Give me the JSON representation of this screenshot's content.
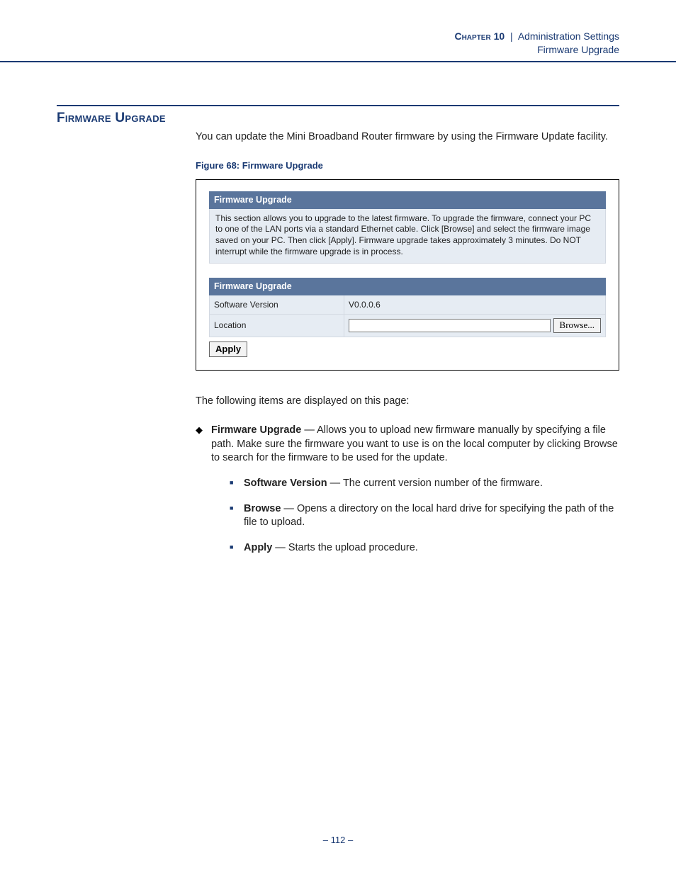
{
  "header": {
    "chapter_label": "Chapter 10",
    "separator": "|",
    "chapter_title": "Administration Settings",
    "subtitle": "Firmware Upgrade"
  },
  "section": {
    "title": "Firmware Upgrade",
    "intro": "You can update the Mini Broadband Router firmware by using the Firmware Update facility.",
    "figure_caption": "Figure 68:  Firmware Upgrade"
  },
  "screenshot": {
    "panel1_title": "Firmware Upgrade",
    "panel1_text": "This section allows you to upgrade to the latest firmware. To upgrade the firmware, connect your PC to one of the LAN ports via a standard Ethernet cable. Click [Browse] and select the firmware image saved on your PC. Then click [Apply]. Firmware upgrade takes approximately 3 minutes. Do NOT interrupt while the firmware upgrade is in process.",
    "panel2_title": "Firmware Upgrade",
    "row1_label": "Software Version",
    "row1_value": "V0.0.0.6",
    "row2_label": "Location",
    "browse_label": "Browse...",
    "apply_label": "Apply"
  },
  "following_intro": "The following items are displayed on this page:",
  "bullets": {
    "main_term": "Firmware Upgrade",
    "main_text": " — Allows you to upload new firmware manually by specifying a file path. Make sure the firmware you want to use is on the local computer by clicking Browse to search for the firmware to be used for the update.",
    "sub": [
      {
        "term": "Software Version",
        "text": " — The current version number of the firmware."
      },
      {
        "term": "Browse",
        "text": " — Opens a directory on the local hard drive for specifying the path of the file to upload."
      },
      {
        "term": "Apply",
        "text": " — Starts the upload procedure."
      }
    ]
  },
  "page_number": "–  112  –"
}
